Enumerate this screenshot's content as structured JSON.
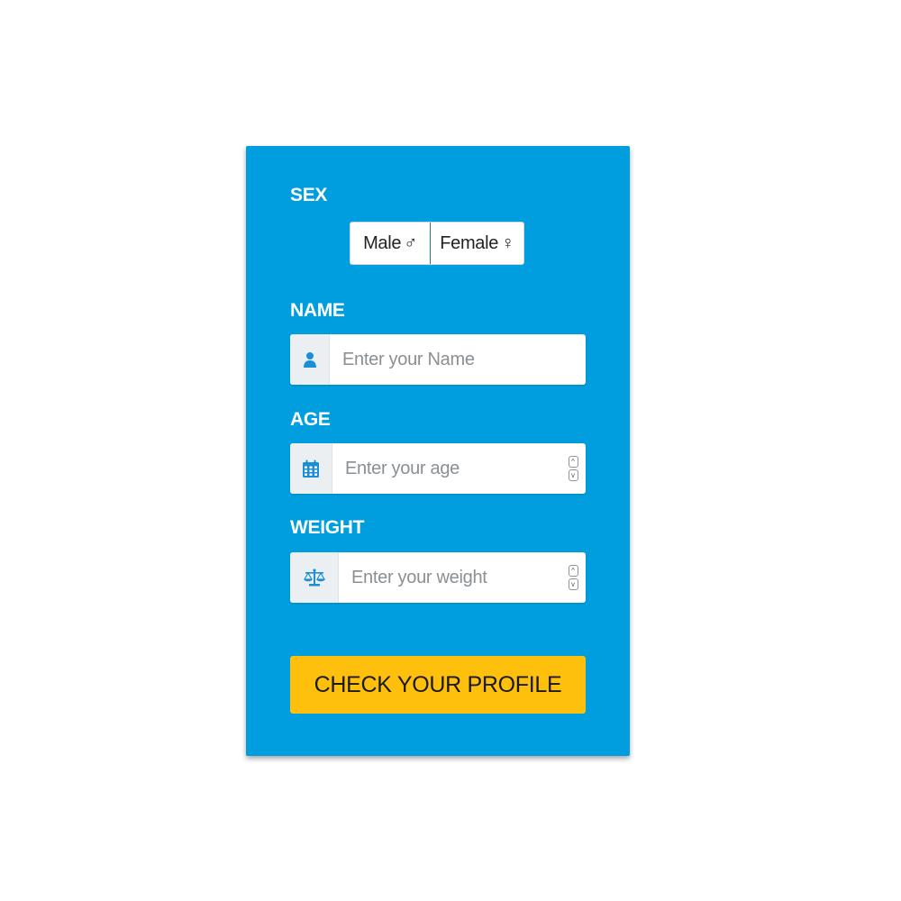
{
  "form": {
    "sex": {
      "label": "SEX",
      "options": [
        {
          "label": "Male",
          "symbol": "♂"
        },
        {
          "label": "Female",
          "symbol": "♀"
        }
      ]
    },
    "name": {
      "label": "NAME",
      "placeholder": "Enter your Name",
      "icon": "user-icon"
    },
    "age": {
      "label": "AGE",
      "placeholder": "Enter your age",
      "icon": "calendar-icon"
    },
    "weight": {
      "label": "WEIGHT",
      "placeholder": "Enter your weight",
      "icon": "scale-icon"
    },
    "submit_label": "CHECK YOUR PROFILE"
  },
  "colors": {
    "card_background": "#009ede",
    "button_background": "#fec00d",
    "icon_color": "#1a8fd6"
  }
}
